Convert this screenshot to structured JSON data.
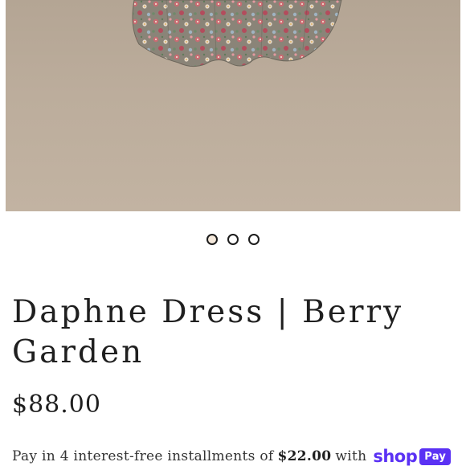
{
  "gallery": {
    "image_alt": "Floral print dress on beige background",
    "dots": [
      {
        "active": true
      },
      {
        "active": false
      },
      {
        "active": false
      }
    ]
  },
  "product": {
    "title": "Daphne Dress | Berry Garden",
    "price": "$88.00"
  },
  "installments": {
    "prefix": "Pay in 4 interest-free installments of",
    "amount": "$22.00",
    "with": "with",
    "shop_word": "shop",
    "pay_word": "Pay"
  },
  "colors": {
    "shop_pay_purple": "#5a31f4",
    "active_dot": "#f4e8db",
    "background_tan": "#bcad9c"
  }
}
